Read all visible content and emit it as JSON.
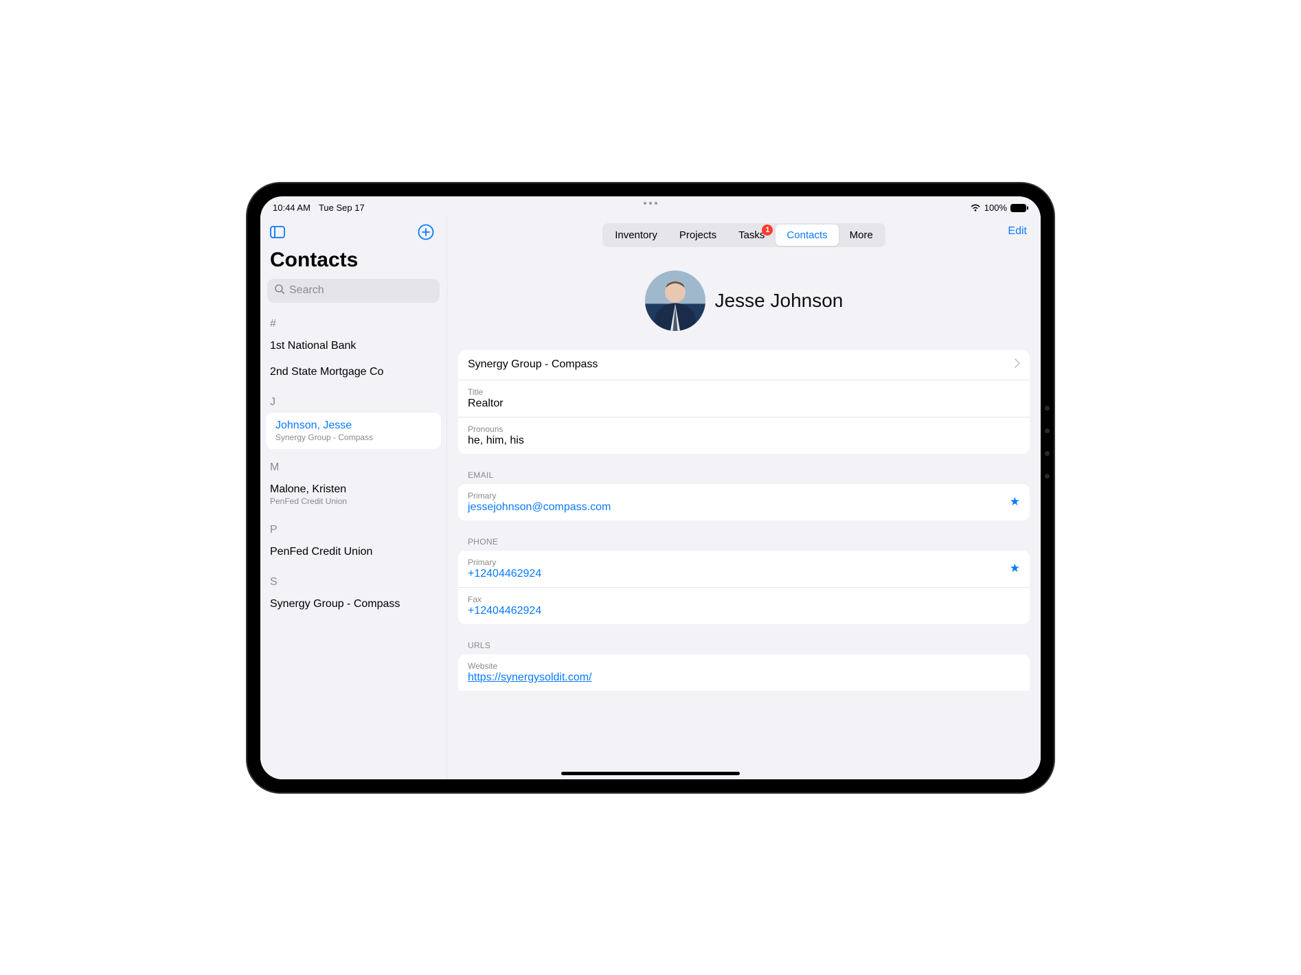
{
  "status": {
    "time": "10:44 AM",
    "date": "Tue Sep 17",
    "battery": "100%"
  },
  "sidebar": {
    "title": "Contacts",
    "search_placeholder": "Search",
    "sections": [
      {
        "letter": "#",
        "items": [
          {
            "name": "1st National Bank"
          },
          {
            "name": "2nd State Mortgage Co"
          }
        ]
      },
      {
        "letter": "J",
        "items": [
          {
            "name": "Johnson, Jesse",
            "sub": "Synergy Group - Compass",
            "selected": true
          }
        ]
      },
      {
        "letter": "M",
        "items": [
          {
            "name": "Malone, Kristen",
            "sub": "PenFed Credit Union"
          }
        ]
      },
      {
        "letter": "P",
        "items": [
          {
            "name": "PenFed Credit Union"
          }
        ]
      },
      {
        "letter": "S",
        "items": [
          {
            "name": "Synergy Group - Compass"
          }
        ]
      }
    ]
  },
  "segments": {
    "items": [
      "Inventory",
      "Projects",
      "Tasks",
      "Contacts",
      "More"
    ],
    "active": "Contacts",
    "badge_on": "Tasks",
    "badge_count": "1"
  },
  "edit_label": "Edit",
  "detail": {
    "name": "Jesse Johnson",
    "company": "Synergy Group - Compass",
    "title_label": "Title",
    "title": "Realtor",
    "pronouns_label": "Pronouns",
    "pronouns": "he, him, his",
    "email_header": "EMAIL",
    "emails": [
      {
        "label": "Primary",
        "value": "jessejohnson@compass.com",
        "star": true
      }
    ],
    "phone_header": "PHONE",
    "phones": [
      {
        "label": "Primary",
        "value": "+12404462924",
        "star": true
      },
      {
        "label": "Fax",
        "value": "+12404462924"
      }
    ],
    "urls_header": "URLS",
    "urls": [
      {
        "label": "Website",
        "value": "https://synergysoldit.com/"
      }
    ]
  }
}
